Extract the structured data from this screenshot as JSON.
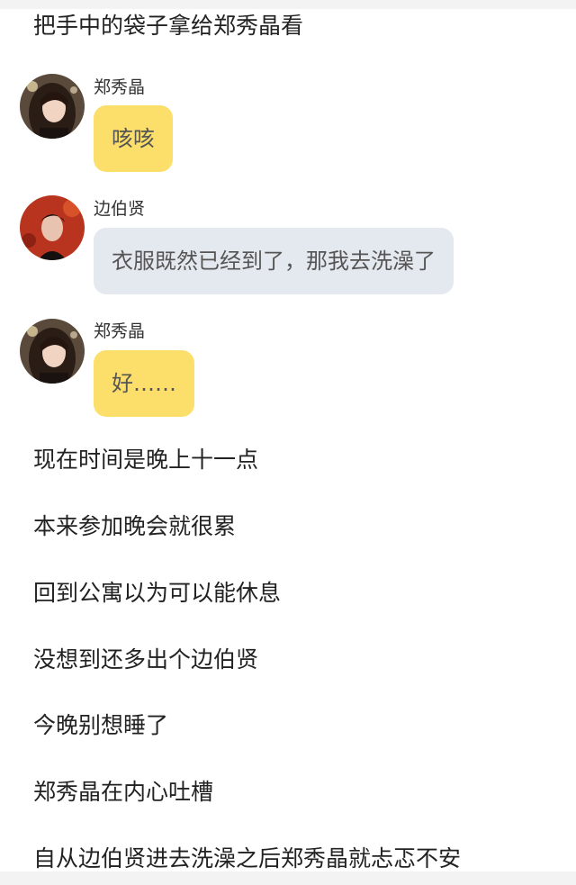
{
  "colors": {
    "bubble_yellow": "#fcdf6a",
    "bubble_gray": "#e4e8ef",
    "text": "#222222"
  },
  "top_line": "把手中的袋子拿给郑秀晶看",
  "messages": [
    {
      "speaker": "郑秀晶",
      "avatar": "avatar-krystal",
      "text": "咳咳",
      "bubble": "yellow"
    },
    {
      "speaker": "边伯贤",
      "avatar": "avatar-baekhyun",
      "text": "衣服既然已经到了，那我去洗澡了",
      "bubble": "gray"
    },
    {
      "speaker": "郑秀晶",
      "avatar": "avatar-krystal",
      "text": "好……",
      "bubble": "yellow"
    }
  ],
  "narration": [
    "现在时间是晚上十一点",
    "本来参加晚会就很累",
    "回到公寓以为可以能休息",
    "没想到还多出个边伯贤",
    "今晚别想睡了",
    "郑秀晶在内心吐槽",
    "自从边伯贤进去洗澡之后郑秀晶就忐忑不安"
  ]
}
